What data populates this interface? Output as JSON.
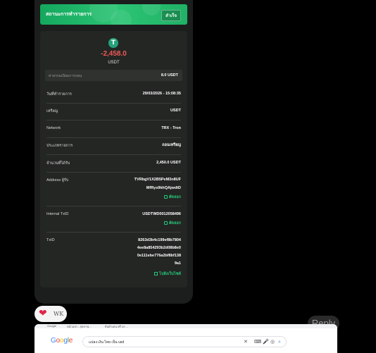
{
  "status": {
    "title": "สถานะการทำรายการ",
    "badge": "สำเร็จ"
  },
  "transaction": {
    "coin_symbol": "T",
    "amount": "-2,458.0",
    "currency": "USDT",
    "fee_label": "ค่าธรรมเนียมการถอน",
    "fee_value": "8.0 USDT",
    "rows": [
      {
        "label": "วันที่ทำรายการ",
        "value": "29/03/2026 - 15:08:35"
      },
      {
        "label": "เหรียญ",
        "value": "USDT"
      },
      {
        "label": "Network",
        "value": "TRX - Tron"
      },
      {
        "label": "ประเภทรายการ",
        "value": "ถอนเหรียญ"
      },
      {
        "label": "จำนวนที่ได้รับ",
        "value": "2,450.0 USDT"
      }
    ],
    "address": {
      "label": "Address ผู้รับ",
      "line1": "TVRbgV1X2B5PeM3n8UF",
      "line2": "MfRys9khQAjwdtD",
      "copy_label": "คัดลอก"
    },
    "internal_txid": {
      "label": "Internal TxID",
      "value": "USDTWD0012058496",
      "copy_label": "คัดลอก"
    },
    "txid": {
      "label": "TxID",
      "line1": "8263d3b4c199ef8b7804",
      "line2": "4ee8a854293b2d08b8e0",
      "line3": "0e111ebe776a2bf8bf138",
      "line4": "9a1",
      "link_label": "ไปยังเว็บไซต์"
    }
  },
  "reaction": {
    "emoji": "❤",
    "count": "WK"
  },
  "reply": {
    "label": "Reply"
  },
  "browser": {
    "bookmarks": [
      "Google",
      "หน้าแรก - สุขภาพ...",
      "สินค้าเด่น ฟรี 20 ..."
    ],
    "logo": "Google",
    "logo_colors": [
      "#4285f4",
      "#ea4335",
      "#fbbc05",
      "#4285f4",
      "#34a853",
      "#ea4335"
    ],
    "search_text": "แปลง เงิน ไทย เป็น usd"
  }
}
